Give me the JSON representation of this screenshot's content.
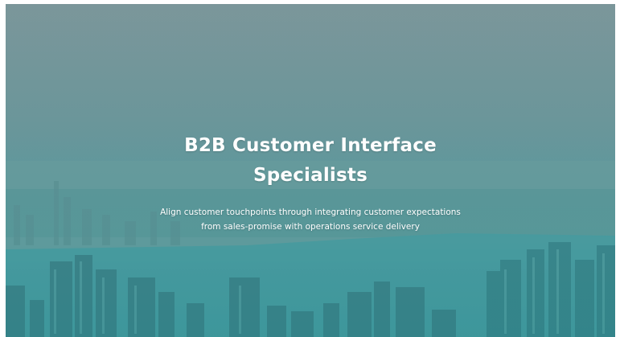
{
  "hero": {
    "title_line1": "B2B Customer Interface",
    "title_line2": "Specialists",
    "subtitle_line1": "Align customer touchpoints through integrating customer expectations",
    "subtitle_line2": "from sales-promise with operations service delivery",
    "background_image": "city-skyline-aerial",
    "colors": {
      "sky": "#7c9a9c",
      "water": "#4f9aa0",
      "teal_overlay": "#2f9393",
      "text": "#ffffff"
    }
  }
}
